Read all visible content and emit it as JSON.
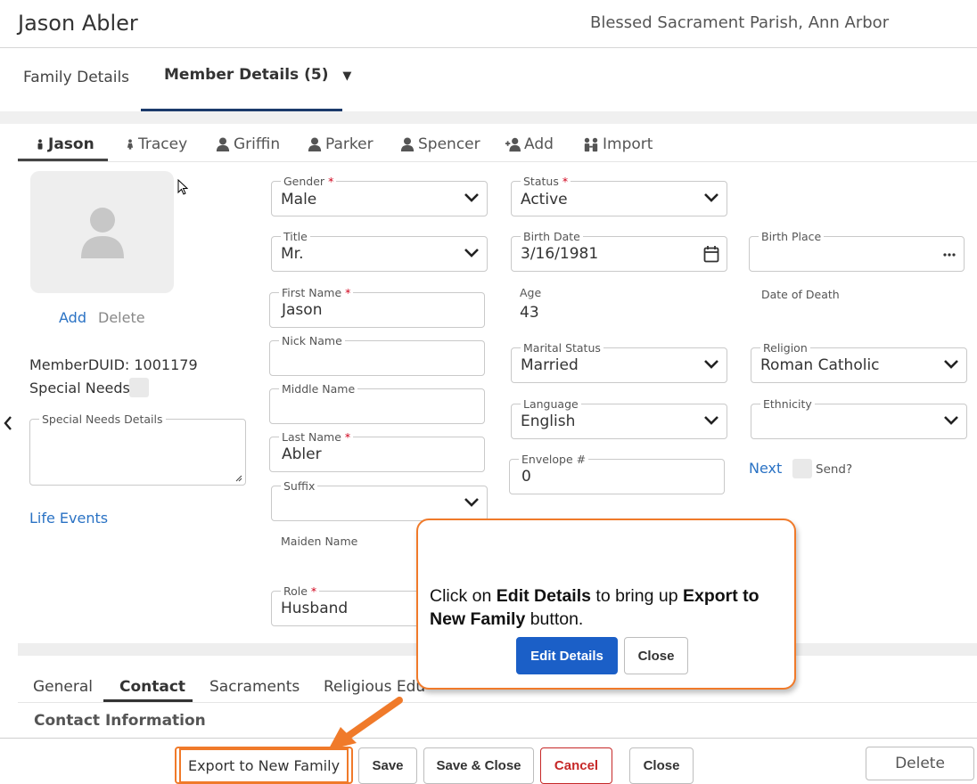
{
  "header": {
    "member_name": "Jason Abler",
    "parish": "Blessed Sacrament Parish, Ann Arbor"
  },
  "top_tabs": {
    "family": "Family Details",
    "member": "Member Details (5)",
    "member_caret": "▼"
  },
  "person_tabs": [
    "Jason",
    "Tracey",
    "Griffin",
    "Parker",
    "Spencer",
    "Add",
    "Import"
  ],
  "avatar": {
    "add": "Add",
    "delete": "Delete"
  },
  "member": {
    "duid": "MemberDUID: 1001179",
    "special_needs": "Special Needs",
    "special_needs_details": "Special Needs Details",
    "life_events": "Life Events"
  },
  "fields": {
    "gender": {
      "label": "Gender",
      "value": "Male"
    },
    "title": {
      "label": "Title",
      "value": "Mr."
    },
    "first_name": {
      "label": "First Name",
      "value": "Jason"
    },
    "nick_name": {
      "label": "Nick Name",
      "value": ""
    },
    "middle_name": {
      "label": "Middle Name",
      "value": ""
    },
    "last_name": {
      "label": "Last Name",
      "value": "Abler"
    },
    "suffix": {
      "label": "Suffix",
      "value": ""
    },
    "maiden_name": {
      "label": "Maiden Name"
    },
    "role": {
      "label": "Role",
      "value": "Husband"
    },
    "status": {
      "label": "Status",
      "value": "Active"
    },
    "birth_date": {
      "label": "Birth Date",
      "value": "3/16/1981"
    },
    "age": {
      "label": "Age",
      "value": "43"
    },
    "marital_status": {
      "label": "Marital Status",
      "value": "Married"
    },
    "language": {
      "label": "Language",
      "value": "English"
    },
    "envelope": {
      "label": "Envelope #",
      "value": "0"
    },
    "birth_place": {
      "label": "Birth Place",
      "value": ""
    },
    "date_of_death": {
      "label": "Date of Death"
    },
    "religion": {
      "label": "Religion",
      "value": "Roman Catholic"
    },
    "ethnicity": {
      "label": "Ethnicity",
      "value": ""
    },
    "next": "Next",
    "send": "Send?",
    "required_mark": "*"
  },
  "lower_tabs": [
    "General",
    "Contact",
    "Sacraments",
    "Religious Edu"
  ],
  "contact_info_heading": "Contact Information",
  "footer": {
    "export": "Export to New Family",
    "save": "Save",
    "save_close": "Save & Close",
    "cancel": "Cancel",
    "close": "Close",
    "delete": "Delete"
  },
  "callout": {
    "t1": "Click on ",
    "b1": "Edit Details",
    "t2": " to bring up ",
    "b2": "Export to New Family",
    "t3": " button.",
    "edit_button": "Edit Details",
    "close_button": "Close"
  },
  "colors": {
    "accent": "#1b5fc7",
    "callout_border": "#f07a2a",
    "link": "#2a72c4",
    "cancel": "#c62828"
  }
}
